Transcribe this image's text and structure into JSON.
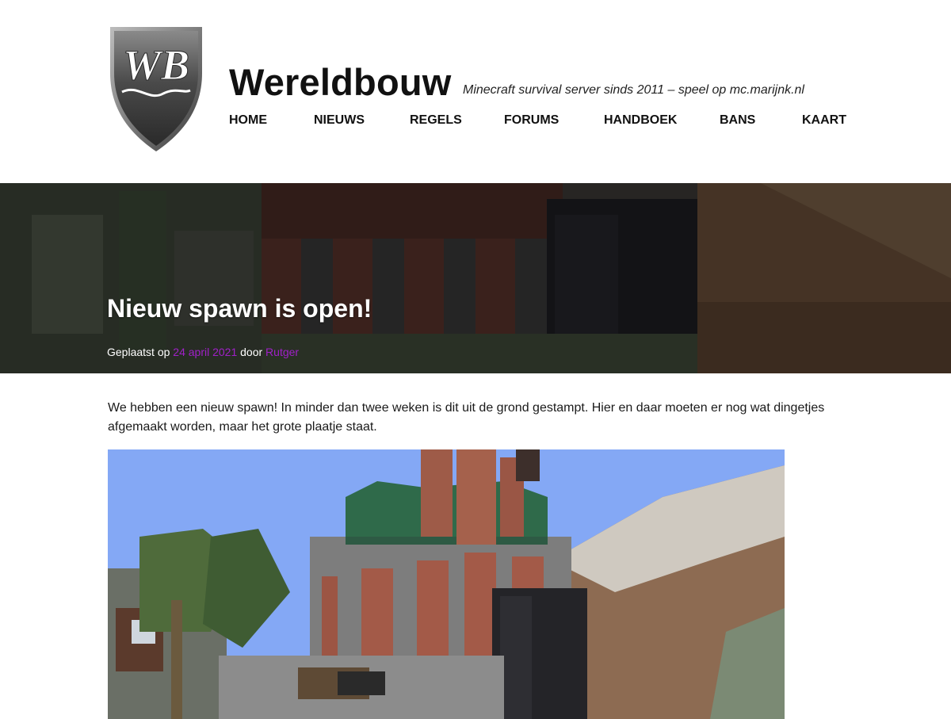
{
  "site": {
    "logo_alt": "WB",
    "title": "Wereldbouw",
    "tagline": "Minecraft survival server sinds 2011 – speel op mc.marijnk.nl"
  },
  "nav": [
    {
      "label": "HOME"
    },
    {
      "label": "NIEUWS"
    },
    {
      "label": "REGELS"
    },
    {
      "label": "FORUMS"
    },
    {
      "label": "HANDBOEK"
    },
    {
      "label": "BANS"
    },
    {
      "label": "KAART"
    }
  ],
  "post": {
    "title": "Nieuw spawn is open!",
    "meta_prefix": "Geplaatst op",
    "date": "24 april 2021",
    "meta_by": "door",
    "author": "Rutger",
    "body": "We hebben een nieuw spawn! In minder dan twee weken is dit uit de grond gestampt. Hier en daar moeten er nog wat dingetjes afgemaakt worden, maar het grote plaatje staat."
  },
  "colors": {
    "link": "#a020c8",
    "text": "#111111",
    "sky": "#84a8f5"
  }
}
